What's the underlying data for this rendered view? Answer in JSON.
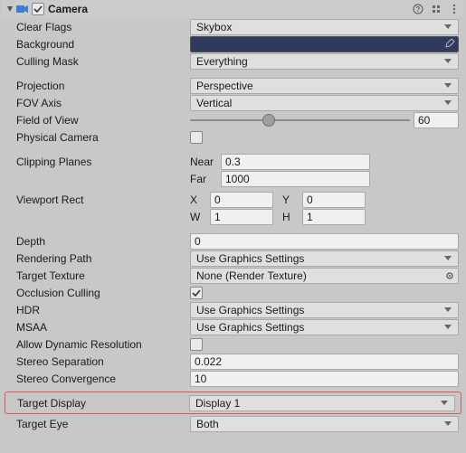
{
  "header": {
    "title": "Camera",
    "enabled": true,
    "foldout_open": true
  },
  "props": {
    "clear_flags_label": "Clear Flags",
    "clear_flags_value": "Skybox",
    "background_label": "Background",
    "background_color": "#303a5e",
    "culling_mask_label": "Culling Mask",
    "culling_mask_value": "Everything",
    "projection_label": "Projection",
    "projection_value": "Perspective",
    "fov_axis_label": "FOV Axis",
    "fov_axis_value": "Vertical",
    "fov_label": "Field of View",
    "fov_value": "60",
    "fov_slider_percent": 33,
    "physical_camera_label": "Physical Camera",
    "physical_camera_checked": false,
    "clipping_planes_label": "Clipping Planes",
    "near_label": "Near",
    "near_value": "0.3",
    "far_label": "Far",
    "far_value": "1000",
    "viewport_rect_label": "Viewport Rect",
    "vr_x_label": "X",
    "vr_x_value": "0",
    "vr_y_label": "Y",
    "vr_y_value": "0",
    "vr_w_label": "W",
    "vr_w_value": "1",
    "vr_h_label": "H",
    "vr_h_value": "1",
    "depth_label": "Depth",
    "depth_value": "0",
    "rendering_path_label": "Rendering Path",
    "rendering_path_value": "Use Graphics Settings",
    "target_texture_label": "Target Texture",
    "target_texture_value": "None (Render Texture)",
    "occlusion_culling_label": "Occlusion Culling",
    "occlusion_culling_checked": true,
    "hdr_label": "HDR",
    "hdr_value": "Use Graphics Settings",
    "msaa_label": "MSAA",
    "msaa_value": "Use Graphics Settings",
    "allow_dynamic_res_label": "Allow Dynamic Resolution",
    "allow_dynamic_res_checked": false,
    "stereo_separation_label": "Stereo Separation",
    "stereo_separation_value": "0.022",
    "stereo_convergence_label": "Stereo Convergence",
    "stereo_convergence_value": "10",
    "target_display_label": "Target Display",
    "target_display_value": "Display 1",
    "target_eye_label": "Target Eye",
    "target_eye_value": "Both"
  }
}
